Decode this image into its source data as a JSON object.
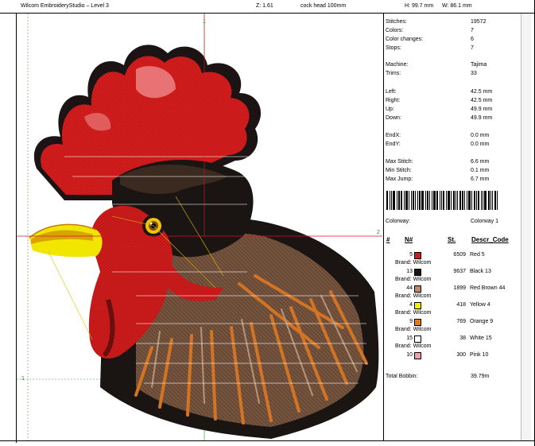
{
  "header": {
    "app_title": "Wilcom EmbroideryStudio – Level 3",
    "zoom": "Z: 1.61",
    "design_name": "cock head 100mm",
    "height": "H: 99.7 mm",
    "width": "W: 86.1 mm"
  },
  "canvas": {
    "markers": [
      "1",
      "2",
      "1"
    ],
    "crosshair_color": "#d2182b"
  },
  "info": {
    "stitches_label": "Stitches:",
    "stitches": "19572",
    "colors_label": "Colors:",
    "colors": "7",
    "color_changes_label": "Color changes:",
    "color_changes": "6",
    "stops_label": "Stops:",
    "stops": "7",
    "machine_label": "Machine:",
    "machine": "Tajima",
    "trims_label": "Trims:",
    "trims": "33",
    "left_label": "Left:",
    "left": "42.5 mm",
    "right_label": "Right:",
    "right": "42.5 mm",
    "up_label": "Up:",
    "up": "49.9 mm",
    "down_label": "Down:",
    "down": "49.9 mm",
    "endx_label": "EndX:",
    "endx": "0.0 mm",
    "endy_label": "EndY:",
    "endy": "0.0 mm",
    "max_stitch_label": "Max Stitch:",
    "max_stitch": "6.6 mm",
    "min_stitch_label": "Min Stitch:",
    "min_stitch": "0.1 mm",
    "max_jump_label": "Max Jump:",
    "max_jump": "6.7 mm",
    "colorway_label": "Colorway:",
    "colorway": "Colorway 1",
    "col_hash": "#",
    "col_n": "N#",
    "col_st": "St.",
    "col_desc": "Descr_Code",
    "total_bobbin_label": "Total Bobbin:",
    "total_bobbin": "39.79m"
  },
  "colors": [
    {
      "n": "5",
      "st": "6509",
      "desc": "Red 5",
      "brand": "Brand: Wilcom",
      "swatch": "#d01c1c"
    },
    {
      "n": "13",
      "st": "9637",
      "desc": "Black 13",
      "brand": "Brand: Wilcom",
      "swatch": "#161616"
    },
    {
      "n": "44",
      "st": "1899",
      "desc": "Red Brown 44",
      "brand": "Brand: Wilcom",
      "swatch": "#c08a6a"
    },
    {
      "n": "4",
      "st": "418",
      "desc": "Yellow 4",
      "brand": "Brand: Wilcom",
      "swatch": "#f5f000"
    },
    {
      "n": "9",
      "st": "769",
      "desc": "Orange 9",
      "brand": "Brand: Wilcom",
      "swatch": "#e07b1e"
    },
    {
      "n": "15",
      "st": "38",
      "desc": "White 15",
      "brand": "Brand: Wilcom",
      "swatch": "#ffffff"
    },
    {
      "n": "10",
      "st": "300",
      "desc": "Pink 10",
      "brand": "",
      "swatch": "#f2a0a6"
    }
  ]
}
